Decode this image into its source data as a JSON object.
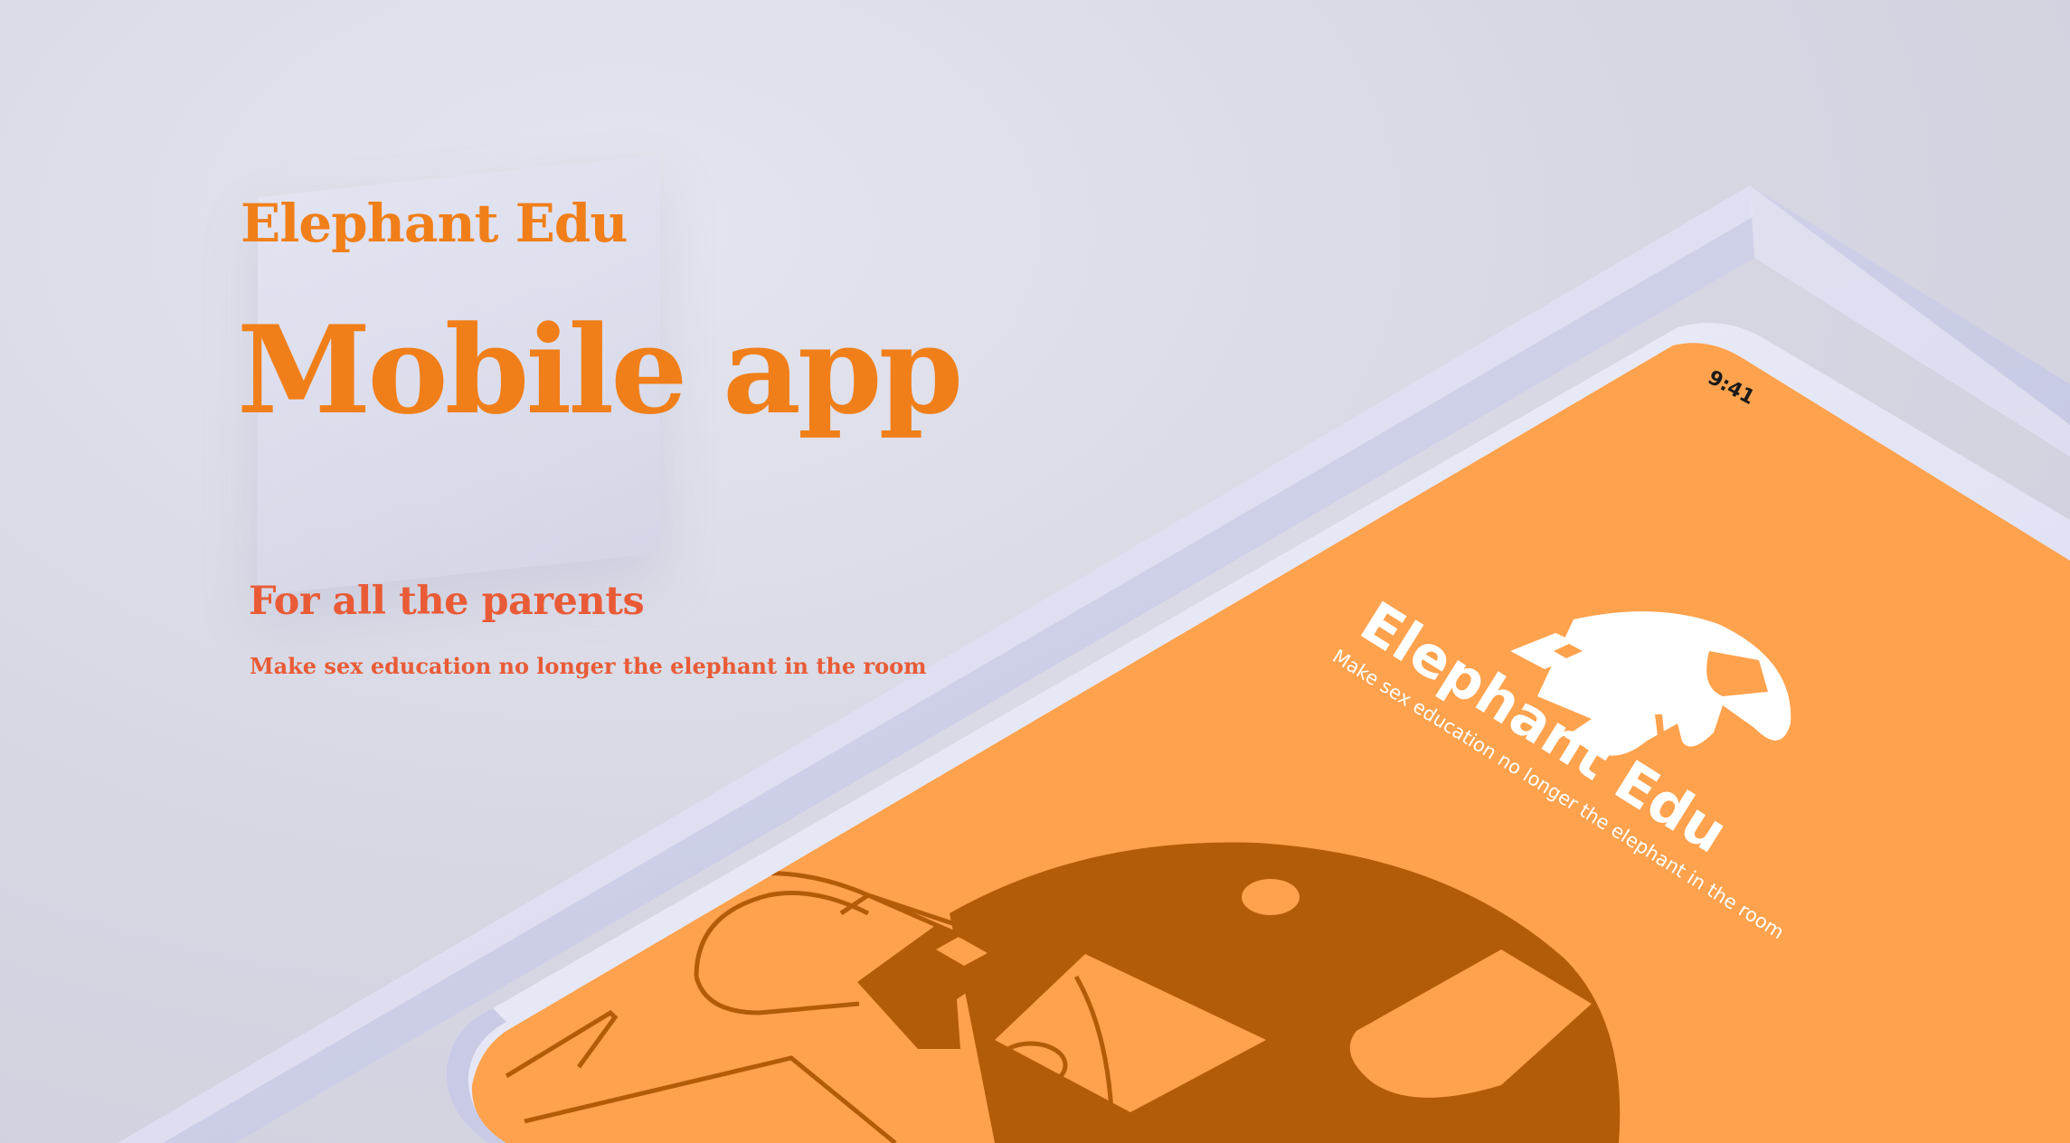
{
  "hero": {
    "brand": "Elephant Edu",
    "headline": "Mobile app",
    "subhead": "For all the parents",
    "tagline": "Make sex education no longer the elephant in the room"
  },
  "phone": {
    "status_time": "9:41",
    "app_name": "Elephant Edu",
    "app_tagline": "Make sex education no longer the elephant in the room"
  },
  "colors": {
    "accent": "#f07f1a",
    "accent_red": "#e95b36",
    "screen": "#ffa24d",
    "screen_dark": "#b35c08",
    "background": "#d5d6e2",
    "frame": "#c3c5e5"
  },
  "icons": [
    "elephant-logo-icon",
    "elephant-illustration-icon"
  ]
}
